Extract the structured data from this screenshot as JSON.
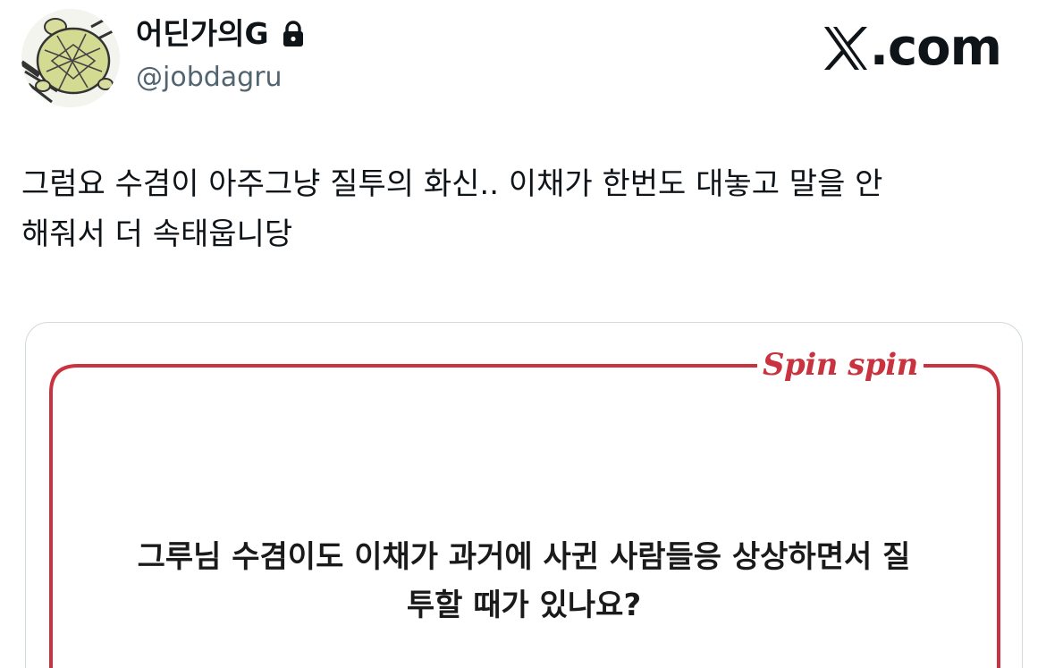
{
  "profile": {
    "display_name": "어딘가의G",
    "handle": "@jobdagru",
    "locked": true
  },
  "brand": {
    "site": ".com",
    "logo_icon": "x-logo-icon"
  },
  "tweet": {
    "line1": "그럼요 수겸이 아주그냥 질투의 화신.. 이채가 한번도 대놓고 말을 안",
    "line2": "해줘서 더 속태웁니당"
  },
  "media": {
    "logo_text": "Spin spin",
    "accent_color": "#c8333f",
    "question_line1": "그루님 수겸이도 이채가 과거에 사귄 사람들응 상상하면서 질",
    "question_line2": "투할 때가 있나요?"
  },
  "icons": {
    "lock": "lock-icon",
    "avatar": "avatar-turtle-image"
  }
}
